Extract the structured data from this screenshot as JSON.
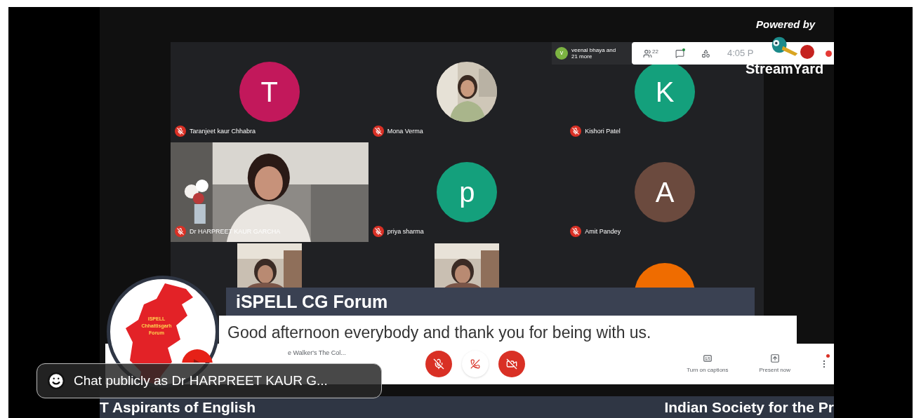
{
  "branding": {
    "powered_by": "Powered by",
    "name": "StreamYard"
  },
  "meet_header": {
    "participants_chip": {
      "initial": "v",
      "text": "veenal bhaya and 21 more"
    },
    "people_count": "22",
    "chat_has_new": true,
    "time": "4:05 P",
    "has_notification": true
  },
  "tiles": [
    {
      "kind": "avatar",
      "letter": "T",
      "color": "#c2185b",
      "name": "Taranjeet kaur Chhabra",
      "muted": true
    },
    {
      "name": "Mona Verma",
      "muted": true
    },
    {
      "kind": "avatar",
      "letter": "K",
      "color": "#14a07c",
      "name": "Kishori Patel",
      "muted": true
    },
    {
      "kind": "video",
      "name": "Dr HARPREET KAUR GARCHA",
      "muted": true
    },
    {
      "kind": "avatar",
      "letter": "p",
      "color": "#14a07c",
      "name": "priya sharma",
      "muted": true
    },
    {
      "kind": "avatar",
      "letter": "A",
      "color": "#6b4a3e",
      "name": "Amit Pandey",
      "muted": true
    },
    {
      "kind": "portrait"
    },
    {
      "kind": "portrait"
    },
    {
      "kind": "avatar",
      "color": "#ef6c00"
    }
  ],
  "bottom_bar": {
    "meeting_title": "e Walker's The Col...",
    "controls": [
      {
        "kind": "mic",
        "off": true
      },
      {
        "kind": "hangup"
      },
      {
        "kind": "camera",
        "off": true
      }
    ],
    "actions": [
      {
        "kind": "captions",
        "label": "Turn on captions"
      },
      {
        "kind": "present",
        "label": "Present now"
      }
    ],
    "more_has_dot": true
  },
  "lower_third": {
    "logo_lines": [
      "iSPELL",
      "Chhattisgarh",
      "Forum"
    ],
    "title": "iSPELL CG Forum",
    "message": "Good afternoon everybody and thank you for being with us."
  },
  "ticker": [
    "T Aspirants of English",
    "Indian Society for the Pr"
  ],
  "chat": {
    "placeholder": "Chat publicly as Dr HARPREET KAUR G..."
  }
}
